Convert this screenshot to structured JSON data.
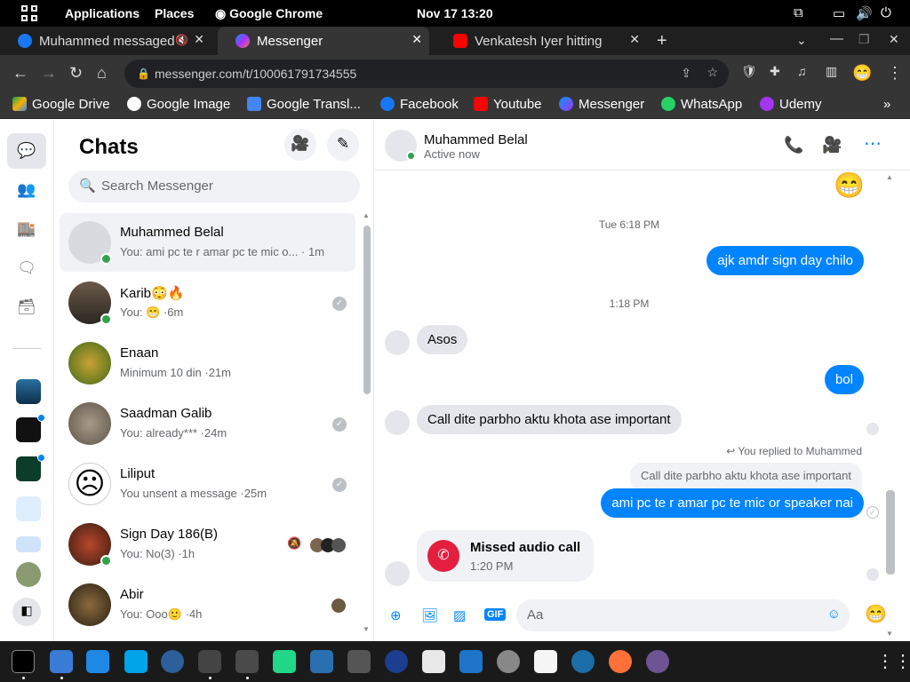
{
  "system_bar": {
    "applications": "Applications",
    "places": "Places",
    "app_name": "Google Chrome",
    "datetime": "Nov 17  13:20"
  },
  "tabs": [
    {
      "title": "Muhammed messaged",
      "icon": "facebook-icon",
      "active": false
    },
    {
      "title": "Messenger",
      "icon": "messenger-icon",
      "active": true
    },
    {
      "title": "Venkatesh Iyer hitting",
      "icon": "youtube-icon",
      "active": false
    }
  ],
  "address_bar": {
    "url": "messenger.com/t/100061791734555"
  },
  "bookmarks": [
    {
      "label": "Google Drive",
      "icon": "drive-icon"
    },
    {
      "label": "Google Image",
      "icon": "google-icon"
    },
    {
      "label": "Google Transl...",
      "icon": "translate-icon"
    },
    {
      "label": "Facebook",
      "icon": "facebook-icon"
    },
    {
      "label": "Youtube",
      "icon": "youtube-icon"
    },
    {
      "label": "Messenger",
      "icon": "messenger-icon"
    },
    {
      "label": "WhatsApp",
      "icon": "whatsapp-icon"
    },
    {
      "label": "Udemy",
      "icon": "udemy-icon"
    }
  ],
  "chats_panel": {
    "title": "Chats",
    "search_placeholder": "Search Messenger",
    "items": [
      {
        "name": "Muhammed Belal",
        "snippet": "You: ami pc te r amar pc te mic o...",
        "time": "· 1m",
        "online": true,
        "selected": true
      },
      {
        "name": "Karib😳🔥",
        "snippet": "You: 😁 ·",
        "time": "6m",
        "online": true,
        "selected": false
      },
      {
        "name": "Enaan",
        "snippet": "Minimum 10 din ·",
        "time": "21m",
        "online": false,
        "selected": false
      },
      {
        "name": "Saadman Galib",
        "snippet": "You: already*** ·",
        "time": "24m",
        "online": false,
        "selected": false
      },
      {
        "name": "Liliput",
        "snippet": "You unsent a message ·",
        "time": "25m",
        "online": false,
        "selected": false
      },
      {
        "name": "Sign Day 186(B)",
        "snippet": "You: No(3) ·",
        "time": "1h",
        "online": true,
        "selected": false
      },
      {
        "name": "Abir",
        "snippet": "You: Ooo🙂 ·",
        "time": "4h",
        "online": false,
        "selected": false
      }
    ]
  },
  "conversation": {
    "name": "Muhammed Belal",
    "status": "Active now",
    "timestamp_1": "Tue 6:18 PM",
    "msg_out_1": "ajk amdr sign day chilo",
    "timestamp_2": "1:18 PM",
    "msg_in_1": "Asos",
    "msg_out_2": "bol",
    "msg_in_2": "Call dite parbho aktu khota ase important",
    "reply_note": "You replied to Muhammed",
    "reply_quote": "Call dite parbho aktu khota ase important",
    "msg_out_3": "ami pc te r amar pc te mic or speaker nai",
    "missed_call_title": "Missed audio call",
    "missed_call_time": "1:20 PM",
    "composer_placeholder": "Aa"
  },
  "colors": {
    "messenger_blue": "#0084ff",
    "online_green": "#31a24c",
    "missed_call_red": "#e41e3f"
  }
}
